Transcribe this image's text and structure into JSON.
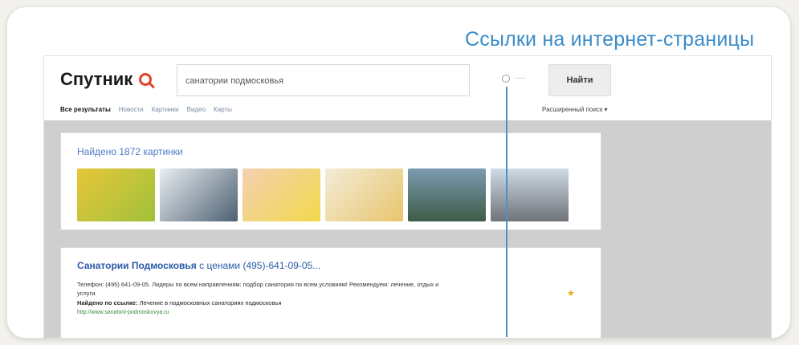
{
  "callout": "Ссылки на интернет-страницы",
  "page": {
    "logo": "Спутник",
    "search_value": "санатории подмосковья",
    "history_hint": "····",
    "find_button": "Найти",
    "tabs": [
      "Все результаты",
      "Новости",
      "Картинки",
      "Видео",
      "Карты"
    ],
    "advanced": "Расширенный поиск ▾"
  },
  "images": {
    "heading": "Найдено 1872 картинки",
    "thumb_colors": [
      "#e6c63a",
      "#d6dfe8",
      "#f1d9b2",
      "#f3ecd7",
      "#4f6a7b",
      "#aab8c6"
    ]
  },
  "result": {
    "title_bold": "Санатории Подмосковья",
    "title_rest": " с ценами (495)-641-09-05...",
    "snippet": "Телефон: (495) 641-09-05. Лидеры по всем направлениям: подбор санатория по всем условиям! Рекомендуем: лечение, отдых и услуги.",
    "links_label": "Найдено по ссылке:",
    "links_text": "Лечение в подмосковных санаториях подмосковья",
    "url": "http://www.sanatorii-podmoskovya.ru"
  }
}
